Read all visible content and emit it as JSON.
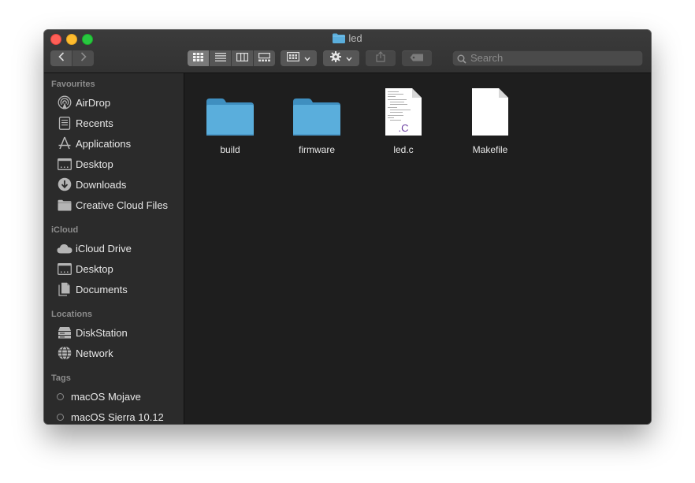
{
  "window": {
    "title": "led"
  },
  "toolbar": {
    "search_placeholder": "Search"
  },
  "sidebar": {
    "sections": {
      "favourites": "Favourites",
      "icloud": "iCloud",
      "locations": "Locations",
      "tags": "Tags"
    },
    "favourites": [
      {
        "label": "AirDrop",
        "icon": "airdrop-icon"
      },
      {
        "label": "Recents",
        "icon": "recents-icon"
      },
      {
        "label": "Applications",
        "icon": "applications-icon"
      },
      {
        "label": "Desktop",
        "icon": "desktop-icon"
      },
      {
        "label": "Downloads",
        "icon": "downloads-icon"
      },
      {
        "label": "Creative Cloud Files",
        "icon": "folder-icon"
      }
    ],
    "icloud": [
      {
        "label": "iCloud Drive",
        "icon": "cloud-icon"
      },
      {
        "label": "Desktop",
        "icon": "desktop-icon"
      },
      {
        "label": "Documents",
        "icon": "documents-icon"
      }
    ],
    "locations": [
      {
        "label": "DiskStation",
        "icon": "server-icon"
      },
      {
        "label": "Network",
        "icon": "network-icon"
      }
    ],
    "tags": [
      {
        "label": "macOS Mojave"
      },
      {
        "label": "macOS Sierra 10.12"
      }
    ]
  },
  "files": [
    {
      "name": "build",
      "kind": "folder"
    },
    {
      "name": "firmware",
      "kind": "folder"
    },
    {
      "name": "led.c",
      "kind": "c-source",
      "badge": ".C"
    },
    {
      "name": "Makefile",
      "kind": "document"
    }
  ],
  "colors": {
    "folder": "#5aaedc",
    "c_badge": "#6b3fa0",
    "close": "#fe5f57",
    "minimize": "#febc2e",
    "maximize": "#28c840"
  }
}
